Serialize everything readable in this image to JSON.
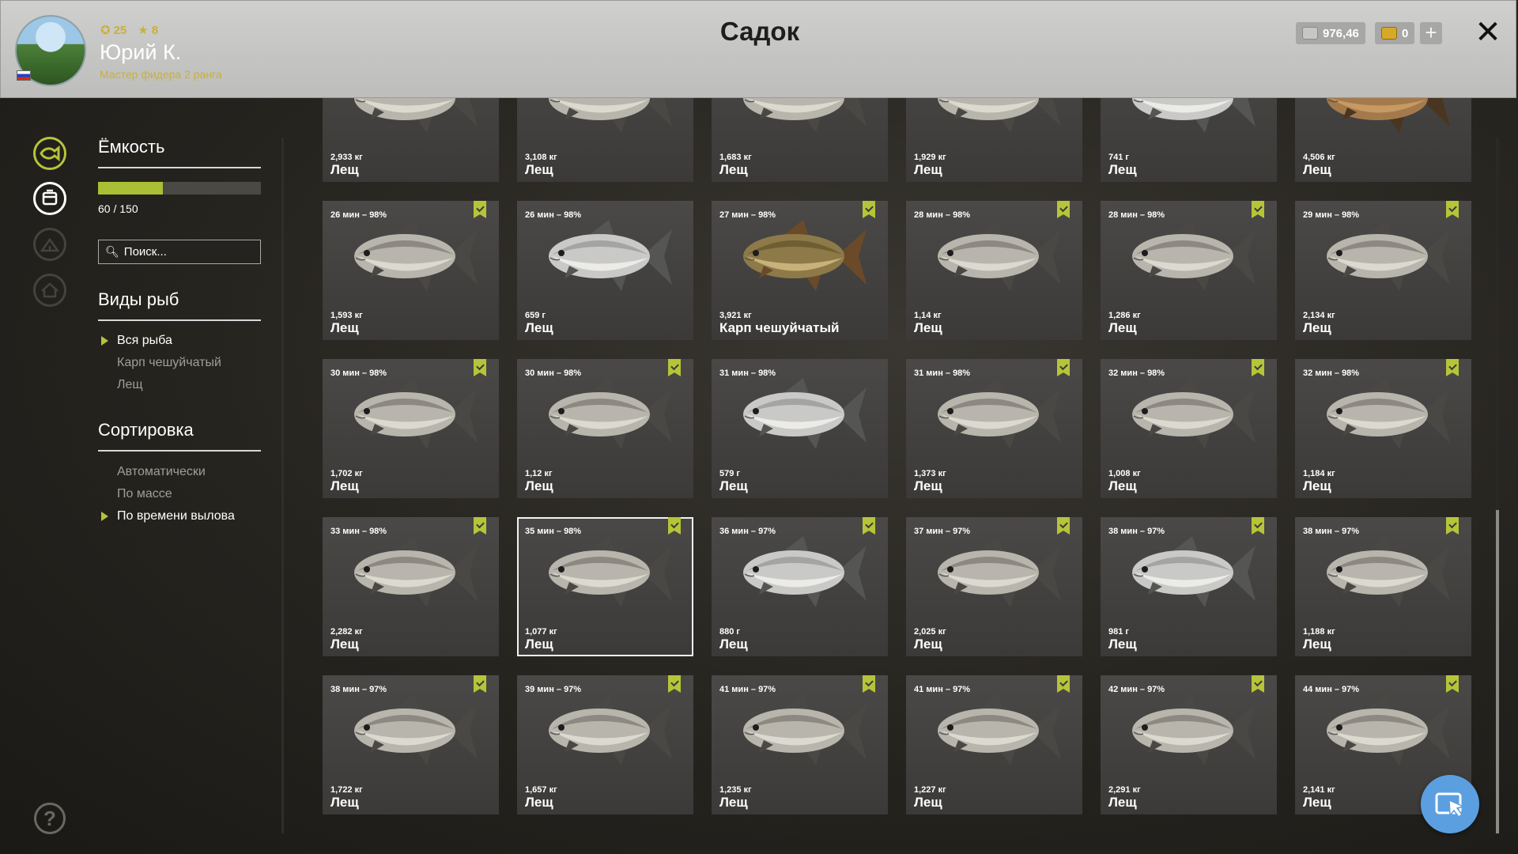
{
  "header": {
    "title": "Садок",
    "user": {
      "name": "Юрий К.",
      "level": "25",
      "stars": "8",
      "rank": "Мастер фидера 2 ранга"
    },
    "silver": "976,46",
    "gold": "0",
    "add_label": "+",
    "close_label": "✕"
  },
  "sidebar": {
    "capacity_title": "Ёмкость",
    "capacity_text": "60 / 150",
    "capacity_fraction": 0.4,
    "search_placeholder": "Поиск...",
    "species_title": "Виды рыб",
    "species": [
      "Вся рыба",
      "Карп чешуйчатый",
      "Лещ"
    ],
    "sort_title": "Сортировка",
    "sort_options": [
      "Автоматически",
      "По массе",
      "По времени вылова"
    ],
    "help_label": "?"
  },
  "catches": [
    {
      "meta": "",
      "weight": "2,933 кг",
      "species": "Лещ",
      "marked": false,
      "fish": "bream"
    },
    {
      "meta": "",
      "weight": "3,108 кг",
      "species": "Лещ",
      "marked": false,
      "fish": "bream"
    },
    {
      "meta": "",
      "weight": "1,683 кг",
      "species": "Лещ",
      "marked": false,
      "fish": "bream"
    },
    {
      "meta": "",
      "weight": "1,929 кг",
      "species": "Лещ",
      "marked": false,
      "fish": "bream"
    },
    {
      "meta": "",
      "weight": "741 г",
      "species": "Лещ",
      "marked": false,
      "fish": "silver"
    },
    {
      "meta": "",
      "weight": "4,506 кг",
      "species": "Лещ",
      "marked": false,
      "fish": "bronze"
    },
    {
      "meta": "26 мин – 98%",
      "weight": "1,593 кг",
      "species": "Лещ",
      "marked": true,
      "fish": "bream"
    },
    {
      "meta": "26 мин – 98%",
      "weight": "659 г",
      "species": "Лещ",
      "marked": false,
      "fish": "silver"
    },
    {
      "meta": "27 мин – 98%",
      "weight": "3,921 кг",
      "species": "Карп чешуйчатый",
      "marked": true,
      "fish": "carp"
    },
    {
      "meta": "28 мин – 98%",
      "weight": "1,14 кг",
      "species": "Лещ",
      "marked": true,
      "fish": "bream"
    },
    {
      "meta": "28 мин – 98%",
      "weight": "1,286 кг",
      "species": "Лещ",
      "marked": true,
      "fish": "bream"
    },
    {
      "meta": "29 мин – 98%",
      "weight": "2,134 кг",
      "species": "Лещ",
      "marked": true,
      "fish": "bream"
    },
    {
      "meta": "30 мин – 98%",
      "weight": "1,702 кг",
      "species": "Лещ",
      "marked": true,
      "fish": "bream"
    },
    {
      "meta": "30 мин – 98%",
      "weight": "1,12 кг",
      "species": "Лещ",
      "marked": true,
      "fish": "bream"
    },
    {
      "meta": "31 мин – 98%",
      "weight": "579 г",
      "species": "Лещ",
      "marked": false,
      "fish": "silver"
    },
    {
      "meta": "31 мин – 98%",
      "weight": "1,373 кг",
      "species": "Лещ",
      "marked": true,
      "fish": "bream"
    },
    {
      "meta": "32 мин – 98%",
      "weight": "1,008 кг",
      "species": "Лещ",
      "marked": true,
      "fish": "bream"
    },
    {
      "meta": "32 мин – 98%",
      "weight": "1,184 кг",
      "species": "Лещ",
      "marked": true,
      "fish": "bream"
    },
    {
      "meta": "33 мин – 98%",
      "weight": "2,282 кг",
      "species": "Лещ",
      "marked": true,
      "fish": "bream"
    },
    {
      "meta": "35 мин – 98%",
      "weight": "1,077 кг",
      "species": "Лещ",
      "marked": true,
      "fish": "bream",
      "selected": true
    },
    {
      "meta": "36 мин – 97%",
      "weight": "880 г",
      "species": "Лещ",
      "marked": true,
      "fish": "silver"
    },
    {
      "meta": "37 мин – 97%",
      "weight": "2,025 кг",
      "species": "Лещ",
      "marked": true,
      "fish": "bream"
    },
    {
      "meta": "38 мин – 97%",
      "weight": "981 г",
      "species": "Лещ",
      "marked": true,
      "fish": "silver"
    },
    {
      "meta": "38 мин – 97%",
      "weight": "1,188 кг",
      "species": "Лещ",
      "marked": true,
      "fish": "bream"
    },
    {
      "meta": "38 мин – 97%",
      "weight": "1,722 кг",
      "species": "Лещ",
      "marked": true,
      "fish": "bream"
    },
    {
      "meta": "39 мин – 97%",
      "weight": "1,657 кг",
      "species": "Лещ",
      "marked": true,
      "fish": "bream"
    },
    {
      "meta": "41 мин – 97%",
      "weight": "1,235 кг",
      "species": "Лещ",
      "marked": true,
      "fish": "bream"
    },
    {
      "meta": "41 мин – 97%",
      "weight": "1,227 кг",
      "species": "Лещ",
      "marked": true,
      "fish": "bream"
    },
    {
      "meta": "42 мин – 97%",
      "weight": "2,291 кг",
      "species": "Лещ",
      "marked": true,
      "fish": "bream"
    },
    {
      "meta": "44 мин – 97%",
      "weight": "2,141 кг",
      "species": "Лещ",
      "marked": true,
      "fish": "bream"
    }
  ],
  "colors": {
    "accent": "#b6c43a",
    "gold": "#c9b03a",
    "card": "#464543",
    "cursor_button": "#5b9fe0"
  }
}
